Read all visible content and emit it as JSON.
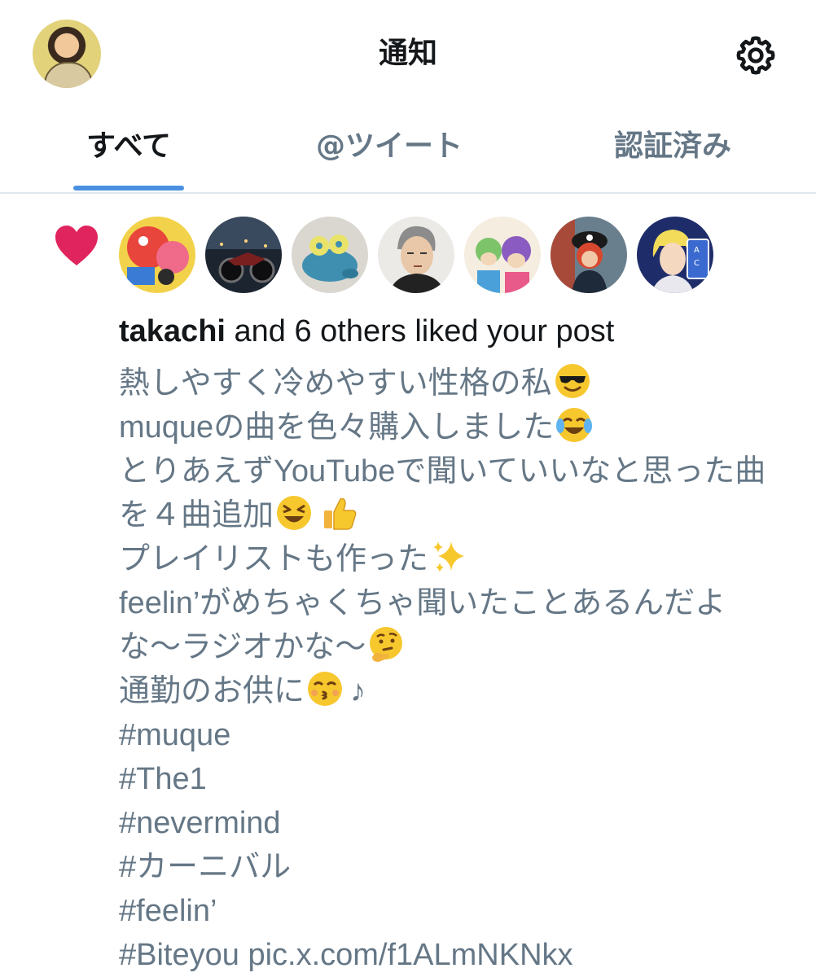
{
  "header": {
    "title": "通知",
    "avatar_icon": "profile-avatar",
    "settings_icon": "gear-icon"
  },
  "tabs": [
    {
      "label": "すべて",
      "active": true
    },
    {
      "label": "@ツイート",
      "active": false
    },
    {
      "label": "認証済み",
      "active": false
    }
  ],
  "notification": {
    "type_icon": "heart-icon",
    "heart_color": "#e0245e",
    "avatars": [
      "avatar-1",
      "avatar-2",
      "avatar-3",
      "avatar-4",
      "avatar-5",
      "avatar-6",
      "avatar-7"
    ],
    "user_name": "takachi",
    "summary_rest": " and 6 others liked your post",
    "lines": [
      {
        "text": "熱しやすく冷めやすい性格の私",
        "emoji": "smiling-face-with-sunglasses-emoji"
      },
      {
        "text": "muqueの曲を色々購入しました",
        "emoji": "face-with-tears-of-joy-emoji"
      },
      {
        "text": "とりあえずYouTubeで聞いていいなと思った曲",
        "emoji": ""
      },
      {
        "text": "を４曲追加",
        "emoji": "grinning-squinting-face-emoji thumbs-up-emoji"
      },
      {
        "text": "プレイリストも作った",
        "emoji": "sparkles-emoji"
      },
      {
        "text": "feelin’がめちゃくちゃ聞いたことあるんだよ",
        "emoji": ""
      },
      {
        "text": "な〜ラジオかな〜",
        "emoji": "thinking-face-emoji"
      },
      {
        "text": "通勤のお供に",
        "emoji": "kissing-face-emoji"
      },
      {
        "text": "#muque",
        "emoji": ""
      },
      {
        "text": "#The1",
        "emoji": ""
      },
      {
        "text": "#nevermind",
        "emoji": ""
      },
      {
        "text": "#カーニバル",
        "emoji": ""
      },
      {
        "text": "#feelin’",
        "emoji": ""
      },
      {
        "text": "#Biteyou pic.x.com/f1ALmNKNkx",
        "emoji": ""
      }
    ],
    "line8_suffix": "♪"
  }
}
